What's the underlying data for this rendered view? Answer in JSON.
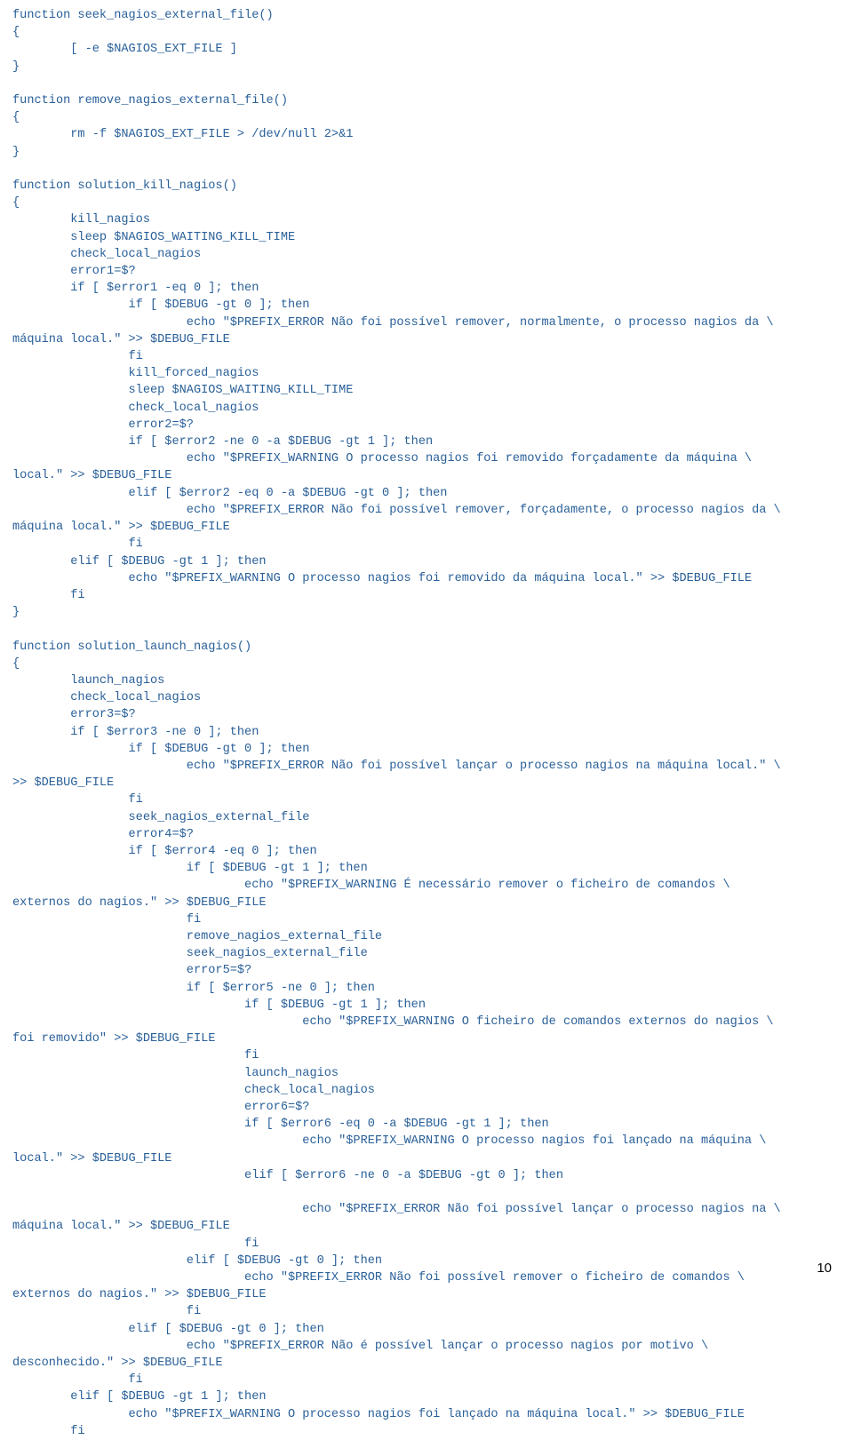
{
  "page_number": "10",
  "code_lines": [
    "function seek_nagios_external_file()",
    "{",
    "        [ -e $NAGIOS_EXT_FILE ]",
    "}",
    "",
    "function remove_nagios_external_file()",
    "{",
    "        rm -f $NAGIOS_EXT_FILE > /dev/null 2>&1",
    "}",
    "",
    "function solution_kill_nagios()",
    "{",
    "        kill_nagios",
    "        sleep $NAGIOS_WAITING_KILL_TIME",
    "        check_local_nagios",
    "        error1=$?",
    "        if [ $error1 -eq 0 ]; then",
    "                if [ $DEBUG -gt 0 ]; then",
    "                        echo \"$PREFIX_ERROR Não foi possível remover, normalmente, o processo nagios da \\",
    "máquina local.\" >> $DEBUG_FILE",
    "                fi",
    "                kill_forced_nagios",
    "                sleep $NAGIOS_WAITING_KILL_TIME",
    "                check_local_nagios",
    "                error2=$?",
    "                if [ $error2 -ne 0 -a $DEBUG -gt 1 ]; then",
    "                        echo \"$PREFIX_WARNING O processo nagios foi removido forçadamente da máquina \\",
    "local.\" >> $DEBUG_FILE",
    "                elif [ $error2 -eq 0 -a $DEBUG -gt 0 ]; then",
    "                        echo \"$PREFIX_ERROR Não foi possível remover, forçadamente, o processo nagios da \\",
    "máquina local.\" >> $DEBUG_FILE",
    "                fi",
    "        elif [ $DEBUG -gt 1 ]; then",
    "                echo \"$PREFIX_WARNING O processo nagios foi removido da máquina local.\" >> $DEBUG_FILE",
    "        fi",
    "}",
    "",
    "function solution_launch_nagios()",
    "{",
    "        launch_nagios",
    "        check_local_nagios",
    "        error3=$?",
    "        if [ $error3 -ne 0 ]; then",
    "                if [ $DEBUG -gt 0 ]; then",
    "                        echo \"$PREFIX_ERROR Não foi possível lançar o processo nagios na máquina local.\" \\",
    ">> $DEBUG_FILE",
    "                fi",
    "                seek_nagios_external_file",
    "                error4=$?",
    "                if [ $error4 -eq 0 ]; then",
    "                        if [ $DEBUG -gt 1 ]; then",
    "                                echo \"$PREFIX_WARNING É necessário remover o ficheiro de comandos \\",
    "externos do nagios.\" >> $DEBUG_FILE",
    "                        fi",
    "                        remove_nagios_external_file",
    "                        seek_nagios_external_file",
    "                        error5=$?",
    "                        if [ $error5 -ne 0 ]; then",
    "                                if [ $DEBUG -gt 1 ]; then",
    "                                        echo \"$PREFIX_WARNING O ficheiro de comandos externos do nagios \\",
    "foi removido\" >> $DEBUG_FILE",
    "                                fi",
    "                                launch_nagios",
    "                                check_local_nagios",
    "                                error6=$?",
    "                                if [ $error6 -eq 0 -a $DEBUG -gt 1 ]; then",
    "                                        echo \"$PREFIX_WARNING O processo nagios foi lançado na máquina \\",
    "local.\" >> $DEBUG_FILE",
    "                                elif [ $error6 -ne 0 -a $DEBUG -gt 0 ]; then",
    "",
    "                                        echo \"$PREFIX_ERROR Não foi possível lançar o processo nagios na \\",
    "máquina local.\" >> $DEBUG_FILE",
    "                                fi",
    "                        elif [ $DEBUG -gt 0 ]; then",
    "                                echo \"$PREFIX_ERROR Não foi possível remover o ficheiro de comandos \\",
    "externos do nagios.\" >> $DEBUG_FILE",
    "                        fi",
    "                elif [ $DEBUG -gt 0 ]; then",
    "                        echo \"$PREFIX_ERROR Não é possível lançar o processo nagios por motivo \\",
    "desconhecido.\" >> $DEBUG_FILE",
    "                fi",
    "        elif [ $DEBUG -gt 1 ]; then",
    "                echo \"$PREFIX_WARNING O processo nagios foi lançado na máquina local.\" >> $DEBUG_FILE",
    "        fi"
  ]
}
